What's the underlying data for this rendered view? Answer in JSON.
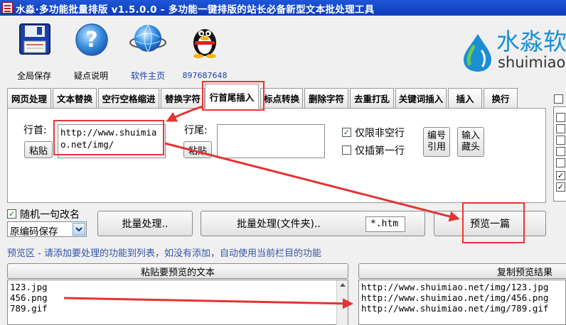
{
  "window": {
    "title": "水淼·多功能批量排版 v1.5.0.0 - 多功能一键排版的站长必备新型文本批处理工具"
  },
  "toolbar": {
    "items": [
      {
        "label": "全局保存",
        "icon": "floppy-disk-icon"
      },
      {
        "label": "疑点说明",
        "icon": "help-question-icon"
      },
      {
        "label": "软件主页",
        "icon": "globe-icon"
      },
      {
        "label": "897687648",
        "icon": "qq-penguin-icon"
      }
    ],
    "brand_cn": "水淼软",
    "brand_en": "shuimiao"
  },
  "tabs": [
    "网页处理",
    "文本替换",
    "空行空格缩进",
    "替换字符",
    "行首尾插入",
    "标点转换",
    "删除字符",
    "去重打乱",
    "关键词插入",
    "插入",
    "换行"
  ],
  "active_tab": "行首尾插入",
  "insert": {
    "head_label": "行首:",
    "head_value": "http://www.shuimiao.net/img/",
    "paste_label": "粘贴",
    "tail_label": "行尾:",
    "tail_value": "",
    "only_nonempty_label": "仅限非空行",
    "only_nonempty_checked": true,
    "first_line_label": "仅插第一行",
    "first_line_checked": false,
    "numbering_label": "编号引用",
    "hide_input_label": "输入藏头"
  },
  "actions": {
    "random_name_label": "随机一句改名",
    "random_name_checked": true,
    "encoding_value": "原编码保存",
    "batch_label": "批量处理..",
    "batch_folder_label": "批量处理(文件夹)..",
    "filter_value": "*.htm",
    "preview_label": "预览一篇"
  },
  "preview": {
    "hint": "预览区 - 请添加要处理的功能到列表，如没有添加，自动使用当前栏目的功能",
    "paste_button": "粘贴要预览的文本",
    "copy_button": "复制预览结果",
    "input_text": "123.jpg\n456.png\n789.gif",
    "output_text": "http://www.shuimiao.net/img/123.jpg\nhttp://www.shuimiao.net/img/456.png\nhttp://www.shuimiao.net/img/789.gif"
  },
  "colors": {
    "titlebar": "#0c3bb6",
    "annotation": "#e33333",
    "hint_text": "#3355aa",
    "brand": "#1a8fd6"
  }
}
